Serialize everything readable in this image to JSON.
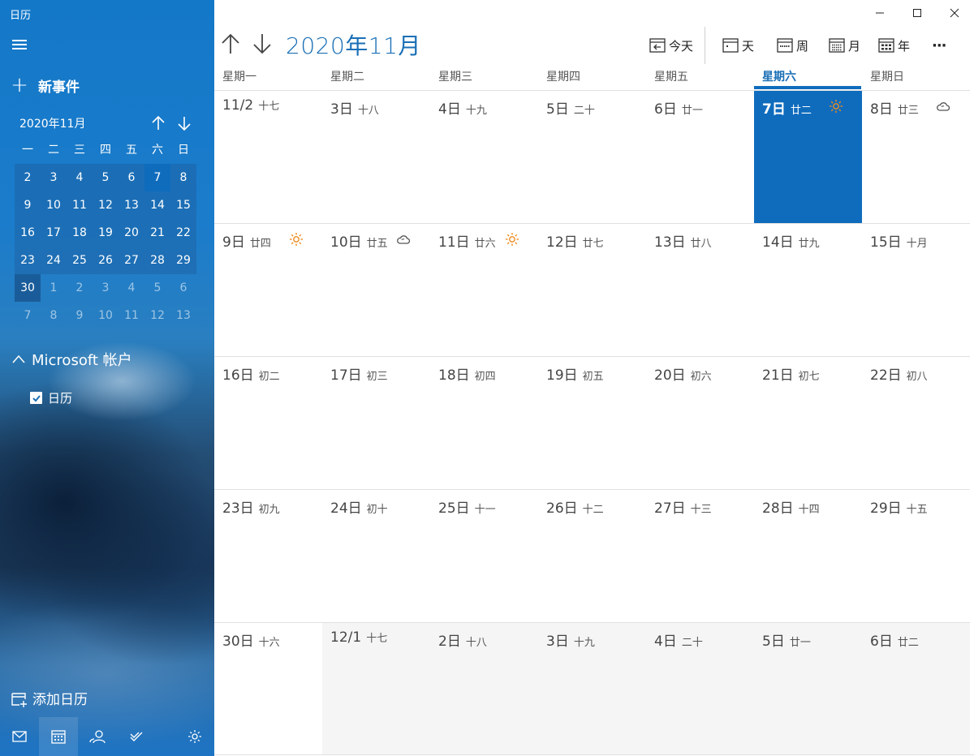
{
  "app": {
    "title": "日历"
  },
  "sidebar": {
    "new_event_label": "新事件",
    "mini_calendar": {
      "title": "2020年11月",
      "weekdays": [
        "一",
        "二",
        "三",
        "四",
        "五",
        "六",
        "日"
      ],
      "rows": [
        [
          "2",
          "3",
          "4",
          "5",
          "6",
          "7",
          "8"
        ],
        [
          "9",
          "10",
          "11",
          "12",
          "13",
          "14",
          "15"
        ],
        [
          "16",
          "17",
          "18",
          "19",
          "20",
          "21",
          "22"
        ],
        [
          "23",
          "24",
          "25",
          "26",
          "27",
          "28",
          "29"
        ],
        [
          "30",
          "1",
          "2",
          "3",
          "4",
          "5",
          "6"
        ],
        [
          "7",
          "8",
          "9",
          "10",
          "11",
          "12",
          "13"
        ]
      ],
      "today": "7",
      "selected": "30"
    },
    "account_label": "Microsoft 帐户",
    "calendar_item_label": "日历",
    "calendar_item_checked": true,
    "add_calendar_label": "添加日历"
  },
  "main": {
    "month_title": "2020年11月",
    "toolbar": {
      "today": "今天",
      "day": "天",
      "week": "周",
      "month": "月",
      "year": "年",
      "more": "···"
    },
    "weekdays": [
      "星期一",
      "星期二",
      "星期三",
      "星期四",
      "星期五",
      "星期六",
      "星期日"
    ],
    "active_weekday": "星期六",
    "weeks": [
      [
        {
          "date": "11/2",
          "lunar": "十七"
        },
        {
          "date": "3日",
          "lunar": "十八"
        },
        {
          "date": "4日",
          "lunar": "十九"
        },
        {
          "date": "5日",
          "lunar": "二十"
        },
        {
          "date": "6日",
          "lunar": "廿一"
        },
        {
          "date": "7日",
          "lunar": "廿二",
          "weather": "sun-icon",
          "today": true
        },
        {
          "date": "8日",
          "lunar": "廿三",
          "weather": "cloud-icon"
        }
      ],
      [
        {
          "date": "9日",
          "lunar": "廿四",
          "weather": "sun-icon"
        },
        {
          "date": "10日",
          "lunar": "廿五",
          "weather": "cloud-icon"
        },
        {
          "date": "11日",
          "lunar": "廿六",
          "weather": "sun-icon"
        },
        {
          "date": "12日",
          "lunar": "廿七"
        },
        {
          "date": "13日",
          "lunar": "廿八"
        },
        {
          "date": "14日",
          "lunar": "廿九"
        },
        {
          "date": "15日",
          "lunar": "十月"
        }
      ],
      [
        {
          "date": "16日",
          "lunar": "初二"
        },
        {
          "date": "17日",
          "lunar": "初三"
        },
        {
          "date": "18日",
          "lunar": "初四"
        },
        {
          "date": "19日",
          "lunar": "初五"
        },
        {
          "date": "20日",
          "lunar": "初六"
        },
        {
          "date": "21日",
          "lunar": "初七"
        },
        {
          "date": "22日",
          "lunar": "初八"
        }
      ],
      [
        {
          "date": "23日",
          "lunar": "初九"
        },
        {
          "date": "24日",
          "lunar": "初十"
        },
        {
          "date": "25日",
          "lunar": "十一"
        },
        {
          "date": "26日",
          "lunar": "十二"
        },
        {
          "date": "27日",
          "lunar": "十三"
        },
        {
          "date": "28日",
          "lunar": "十四"
        },
        {
          "date": "29日",
          "lunar": "十五"
        }
      ],
      [
        {
          "date": "30日",
          "lunar": "十六"
        },
        {
          "date": "12/1",
          "lunar": "十七",
          "next_month": true
        },
        {
          "date": "2日",
          "lunar": "十八",
          "next_month": true
        },
        {
          "date": "3日",
          "lunar": "十九",
          "next_month": true
        },
        {
          "date": "4日",
          "lunar": "二十",
          "next_month": true
        },
        {
          "date": "5日",
          "lunar": "廿一",
          "next_month": true
        },
        {
          "date": "6日",
          "lunar": "廿二",
          "next_month": true
        }
      ]
    ]
  },
  "colors": {
    "accent": "#0f6cbd",
    "title_blue": "#1a6fb6",
    "weather_sun": "#f08c1e"
  }
}
